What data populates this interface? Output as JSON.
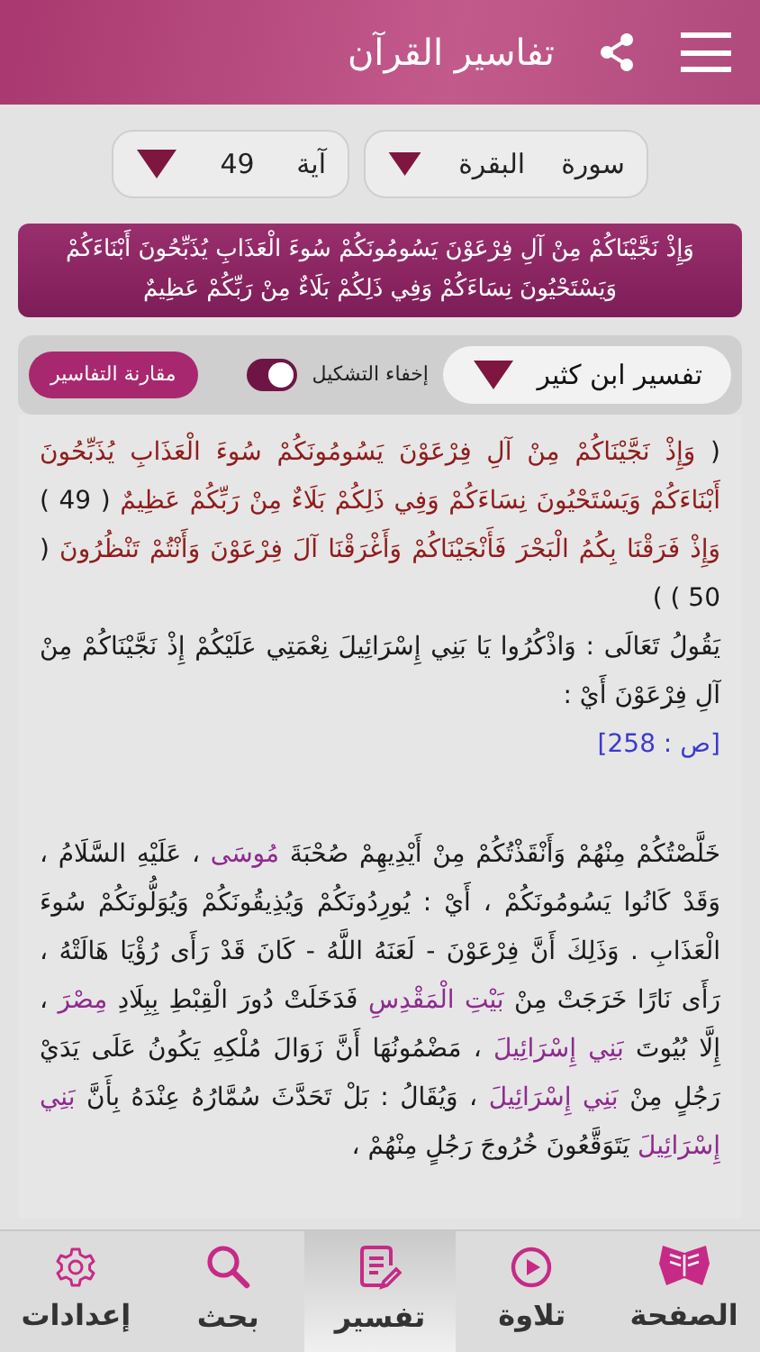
{
  "header": {
    "title": "تفاسير القرآن"
  },
  "selectors": [
    {
      "label": "سورة",
      "value": "البقرة"
    },
    {
      "label": "آية",
      "value": "49"
    }
  ],
  "ayah_banner": "وَإِذْ نَجَّيْنَاكُمْ مِنْ آلِ فِرْعَوْنَ يَسُومُونَكُمْ سُوءَ الْعَذَابِ يُذَبِّحُونَ أَبْنَاءَكُمْ وَيَسْتَحْيُونَ نِسَاءَكُمْ وَفِي ذَلِكُمْ بَلَاءٌ مِنْ رَبِّكُمْ عَظِيمٌ",
  "controls": {
    "tafsir": "تفسير ابن كثير",
    "toggle_label": "إخفاء التشكيل",
    "toggle_on": true,
    "compare_button": "مقارنة التفاسير"
  },
  "tafsir_paragraphs": [
    {
      "segments": [
        {
          "kind": "plain",
          "text": "("
        },
        {
          "kind": "quran",
          "text": "وَإِذْ نَجَّيْنَاكُمْ مِنْ آلِ فِرْعَوْنَ يَسُومُونَكُمْ سُوءَ الْعَذَابِ يُذَبِّحُونَ أَبْنَاءَكُمْ وَيَسْتَحْيُونَ نِسَاءَكُمْ وَفِي ذَلِكُمْ بَلَاءٌ مِنْ رَبِّكُمْ عَظِيمٌ"
        },
        {
          "kind": "plain",
          "text": "( 49 )"
        },
        {
          "kind": "quran",
          "text": "وَإِذْ فَرَقْنَا بِكُمُ الْبَحْرَ فَأَنْجَيْنَاكُمْ وَأَغْرَقْنَا آلَ فِرْعَوْنَ وَأَنْتُمْ تَنْظُرُونَ"
        },
        {
          "kind": "plain",
          "text": "( 50 ) )"
        }
      ]
    },
    {
      "segments": [
        {
          "kind": "plain",
          "text": "يَقُولُ تَعَالَى : وَاذْكُرُوا يَا بَنِي إِسْرَائِيلَ نِعْمَتِي عَلَيْكُمْ إِذْ نَجَّيْنَاكُمْ مِنْ آلِ فِرْعَوْنَ أَيْ :"
        }
      ]
    },
    {
      "segments": [
        {
          "kind": "ref",
          "text": "[ص : 258]"
        }
      ]
    },
    {
      "segments": [
        {
          "kind": "plain",
          "text": "خَلَّصْتُكُمْ مِنْهُمْ وَأَنْقَذْتُكُمْ مِنْ أَيْدِيهِمْ صُحْبَةَ"
        },
        {
          "kind": "name",
          "text": "مُوسَى"
        },
        {
          "kind": "plain",
          "text": "، عَلَيْهِ السَّلَامُ ، وَقَدْ كَانُوا يَسُومُونَكُمْ ، أَيْ : يُورِدُونَكُمْ وَيُذِيقُونَكُمْ وَيُوَلُّونَكُمْ سُوءَ الْعَذَابِ . وَذَلِكَ أَنَّ فِرْعَوْنَ - لَعَنَهُ اللَّهُ - كَانَ قَدْ رَأَى رُؤْيَا هَالَتْهُ ، رَأَى نَارًا خَرَجَتْ مِنْ"
        },
        {
          "kind": "name",
          "text": "بَيْتِ الْمَقْدِسِ"
        },
        {
          "kind": "plain",
          "text": "فَدَخَلَتْ دُورَ الْقِبْطِ بِبِلَادِ"
        },
        {
          "kind": "name",
          "text": "مِصْرَ"
        },
        {
          "kind": "plain",
          "text": "، إِلَّا بُيُوتَ"
        },
        {
          "kind": "name",
          "text": "بَنِي إِسْرَائِيلَ"
        },
        {
          "kind": "plain",
          "text": "، مَضْمُونُهَا أَنَّ زَوَالَ مُلْكِهِ يَكُونُ عَلَى يَدَيْ رَجُلٍ مِنْ"
        },
        {
          "kind": "name",
          "text": "بَنِي إِسْرَائِيلَ"
        },
        {
          "kind": "plain",
          "text": "، وَيُقَالُ : بَلْ تَحَدَّثَ سُمَّارُهُ عِنْدَهُ بِأَنَّ"
        },
        {
          "kind": "name",
          "text": "بَنِي إِسْرَائِيلَ"
        },
        {
          "kind": "plain",
          "text": "يَتَوَقَّعُونَ خُرُوجَ رَجُلٍ مِنْهُمْ ،"
        }
      ]
    }
  ],
  "tabs": [
    {
      "label": "الصفحة",
      "selected": false
    },
    {
      "label": "تلاوة",
      "selected": false
    },
    {
      "label": "تفسير",
      "selected": true
    },
    {
      "label": "بحث",
      "selected": false
    },
    {
      "label": "إعدادات",
      "selected": false
    }
  ]
}
